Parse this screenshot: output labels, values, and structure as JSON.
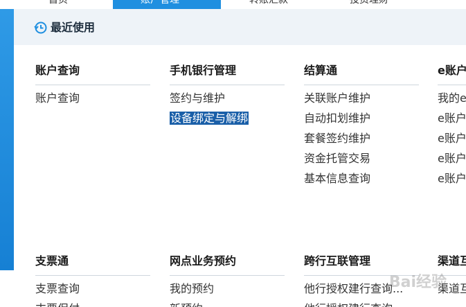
{
  "topnav": {
    "tabs": [
      {
        "label": "首页"
      },
      {
        "label": "账户管理"
      },
      {
        "label": "转账汇款"
      },
      {
        "label": "投资理财"
      }
    ]
  },
  "recent": {
    "label": "最近使用",
    "icon": "clock-history-icon"
  },
  "colors": {
    "accent": "#1f8fe0",
    "highlight": "#1a5fa8"
  },
  "sections": [
    {
      "title": "账户查询",
      "items": [
        "账户查询"
      ]
    },
    {
      "title": "手机银行管理",
      "items": [
        "签约与维护",
        "设备绑定与解绑"
      ]
    },
    {
      "title": "结算通",
      "items": [
        "关联账户维护",
        "自动扣划维护",
        "套餐签约维护",
        "资金托管交易",
        "基本信息查询"
      ]
    },
    {
      "title": "e账户",
      "items": [
        "我的e账户",
        "e账户",
        "e账户",
        "e账户",
        "e账户"
      ]
    },
    {
      "title": "支票通",
      "items": [
        "支票查询",
        "支票保付"
      ]
    },
    {
      "title": "网点业务预约",
      "items": [
        "我的预约",
        "新预约"
      ]
    },
    {
      "title": "跨行互联管理",
      "items": [
        "他行授权建行查询...",
        "他行授权建行查询"
      ]
    },
    {
      "title": "渠道互联",
      "items": [
        "渠道互联"
      ]
    }
  ],
  "highlighted_item": "设备绑定与解绑",
  "watermark": "Bai经验"
}
